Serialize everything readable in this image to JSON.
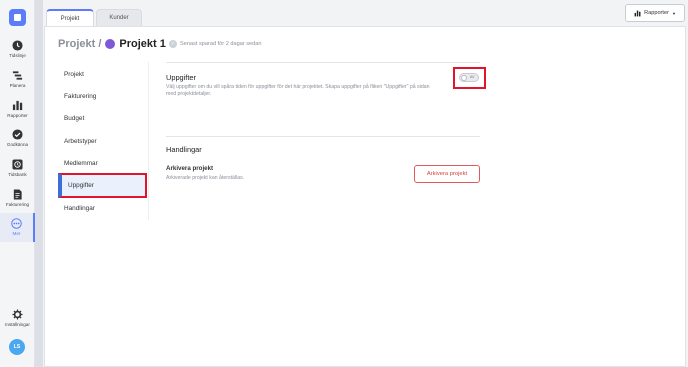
{
  "rail": {
    "items": [
      {
        "label": "Tidslinje",
        "icon": "clock-icon"
      },
      {
        "label": "Planera",
        "icon": "gantt-icon"
      },
      {
        "label": "Rapporter",
        "icon": "bar-chart-icon"
      },
      {
        "label": "Godkänna",
        "icon": "check-circle-icon"
      },
      {
        "label": "Tidsbank",
        "icon": "time-bank-icon"
      },
      {
        "label": "Fakturering",
        "icon": "invoice-icon"
      },
      {
        "label": "Mer",
        "icon": "more-icon"
      },
      {
        "label": "Inställningar",
        "icon": "gear-icon"
      }
    ],
    "avatar": "LS"
  },
  "tabs": [
    {
      "label": "Projekt",
      "active": true
    },
    {
      "label": "Kunder",
      "active": false
    }
  ],
  "reports_button": {
    "label": "Rapporter",
    "icon": "bar-chart-icon"
  },
  "breadcrumb": {
    "parent": "Projekt /",
    "current": "Projekt 1"
  },
  "saved_status": "Senast sparad för 2 dagar sedan",
  "menu": [
    {
      "label": "Projekt",
      "active": false
    },
    {
      "label": "Fakturering",
      "active": false
    },
    {
      "label": "Budget",
      "active": false
    },
    {
      "label": "Arbetstyper",
      "active": false
    },
    {
      "label": "Medlemmar",
      "active": false
    },
    {
      "label": "Uppgifter",
      "active": true
    },
    {
      "label": "Handlingar",
      "active": false
    }
  ],
  "uppgifter": {
    "title": "Uppgifter",
    "description": "Välj uppgifter om du vill spåra tiden för uppgifter för det här projektet. Skapa uppgifter på fliken \"Uppgifter\" på sidan med projektdetaljer.",
    "toggle_label": "AV",
    "toggle_on": false
  },
  "handlingar": {
    "title": "Handlingar",
    "archive_title": "Arkivera projekt",
    "archive_desc": "Arkiverade projekt kan återställas.",
    "archive_button": "Arkivera projekt"
  },
  "colors": {
    "accent": "#5c7cfa",
    "highlight": "#e0142d",
    "danger": "#d8413f",
    "project": "#7d5bd6"
  }
}
